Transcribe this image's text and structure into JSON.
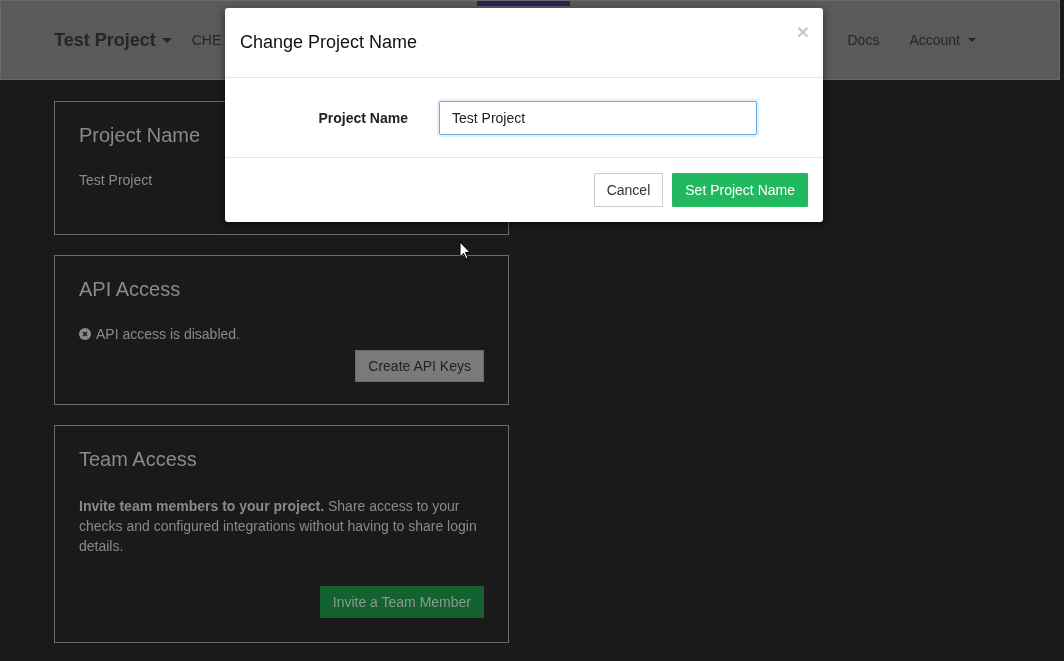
{
  "navbar": {
    "brand": "Test Project",
    "brand_dropdown": true,
    "items": [
      {
        "label": "CHE"
      },
      {
        "label": "Docs"
      },
      {
        "label": "Account",
        "dropdown": true
      }
    ],
    "active_indicator": true
  },
  "cards": [
    {
      "kind": "text",
      "title": "Project Name",
      "text": "Test Project"
    },
    {
      "kind": "status",
      "title": "API Access",
      "status": "API access is disabled.",
      "button": {
        "label": "Create API Keys"
      }
    },
    {
      "kind": "paragraph",
      "title": "Team Access",
      "text": "**Invite team members to your project.** Share access to your checks and configured integrations without having to share login details.",
      "button": {
        "label": "Invite a Team Member"
      }
    }
  ],
  "modal": {
    "title": "Change Project Name",
    "close": "×",
    "field": {
      "label": "Project Name",
      "value": "Test Project"
    },
    "buttons": [
      {
        "label": "Cancel"
      },
      {
        "label": "Set Project Name"
      }
    ]
  }
}
